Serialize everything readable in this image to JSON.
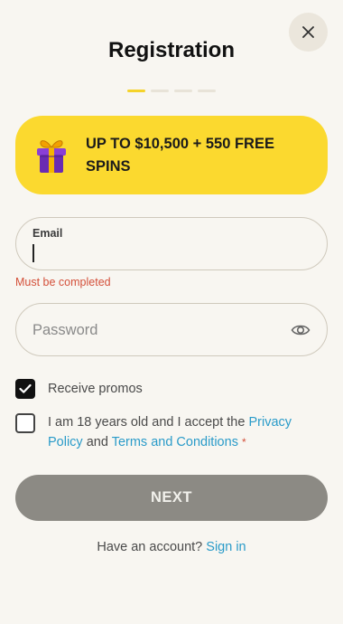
{
  "header": {
    "title": "Registration",
    "steps_total": 4,
    "active_step": 1
  },
  "promo": {
    "text": "UP TO $10,500 + 550 FREE SPINS",
    "icon": "gift-icon"
  },
  "email": {
    "label": "Email",
    "value": "",
    "error": "Must be completed"
  },
  "password": {
    "placeholder": "Password",
    "toggle_icon": "eye-icon"
  },
  "checkboxes": {
    "promos": {
      "label": "Receive promos",
      "checked": true
    },
    "terms": {
      "checked": false,
      "text_before": "I am 18 years old and I accept the",
      "privacy_link": "Privacy Policy",
      "connector": "and",
      "terms_link": "Terms and Conditions",
      "required_mark": "*"
    }
  },
  "actions": {
    "next_label": "NEXT"
  },
  "signin": {
    "prompt": "Have an account?",
    "link_label": "Sign in"
  },
  "colors": {
    "background": "#f8f6f1",
    "promo_yellow": "#fbd92f",
    "link_blue": "#2a9bc9",
    "error_red": "#d4513b",
    "button_disabled": "#8c8a84"
  }
}
